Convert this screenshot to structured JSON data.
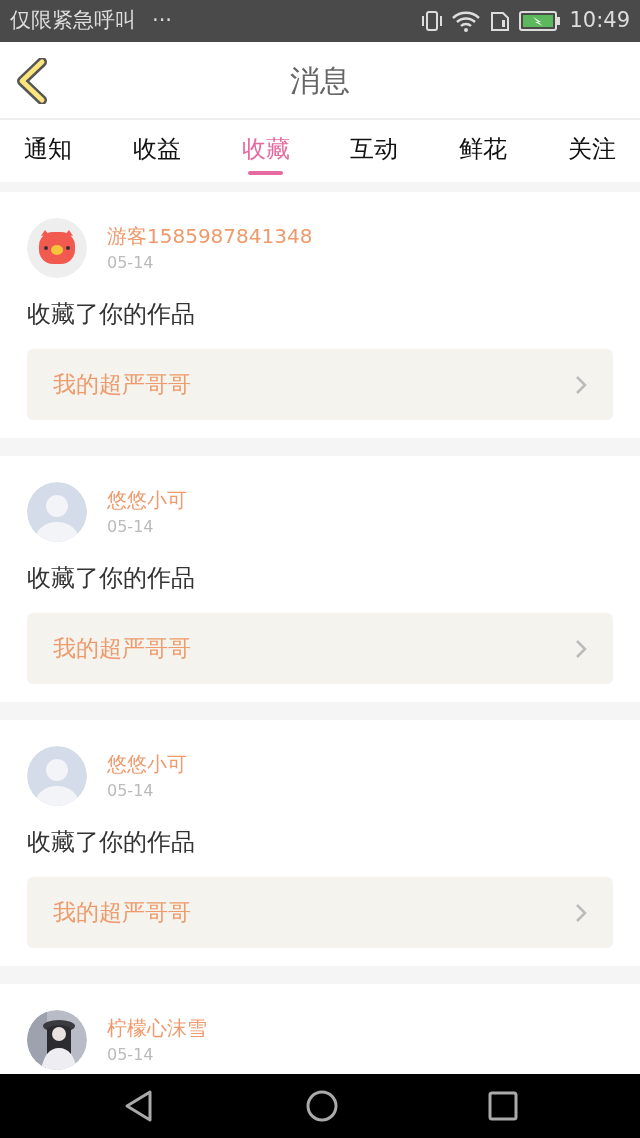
{
  "status_bar": {
    "carrier": "仅限紧急呼叫",
    "more": "···",
    "time": "10:49"
  },
  "header": {
    "title": "消息"
  },
  "tabs": [
    {
      "label": "通知",
      "selected": false
    },
    {
      "label": "收益",
      "selected": false
    },
    {
      "label": "收藏",
      "selected": true
    },
    {
      "label": "互动",
      "selected": false
    },
    {
      "label": "鲜花",
      "selected": false
    },
    {
      "label": "关注",
      "selected": false
    }
  ],
  "messages": [
    {
      "avatar": {
        "kind": "pig"
      },
      "name": "游客1585987841348",
      "date": "05-14",
      "action": "收藏了你的作品",
      "work": "我的超严哥哥"
    },
    {
      "avatar": {
        "kind": "default"
      },
      "name": "悠悠小可",
      "date": "05-14",
      "action": "收藏了你的作品",
      "work": "我的超严哥哥"
    },
    {
      "avatar": {
        "kind": "default"
      },
      "name": "悠悠小可",
      "date": "05-14",
      "action": "收藏了你的作品",
      "work": "我的超严哥哥"
    },
    {
      "name": "柠檬心沫雪",
      "date": "05-14"
    }
  ]
}
